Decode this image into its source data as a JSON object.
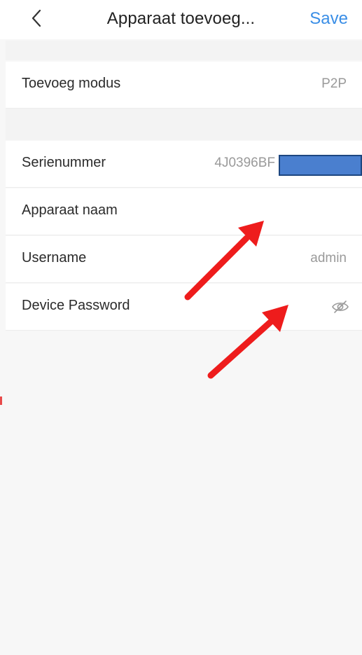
{
  "header": {
    "title": "Apparaat toevoeg...",
    "save_label": "Save"
  },
  "rows": {
    "mode": {
      "label": "Toevoeg modus",
      "value": "P2P"
    },
    "serial": {
      "label": "Serienummer",
      "value": "4J0396BF"
    },
    "name": {
      "label": "Apparaat naam",
      "value": ""
    },
    "username": {
      "label": "Username",
      "value": "admin"
    },
    "password": {
      "label": "Device Password",
      "value": ""
    }
  },
  "icons": {
    "back": "chevron-left-icon",
    "password_visibility": "eye-off-icon"
  },
  "colors": {
    "accent": "#3a8ee6",
    "annotation_arrow": "#ee1c1c",
    "redaction": "#4a7fcf"
  }
}
